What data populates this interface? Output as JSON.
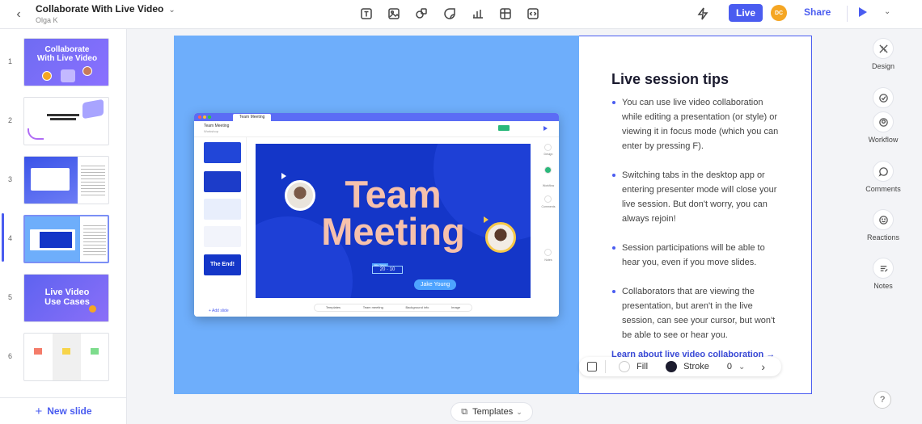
{
  "header": {
    "title": "Collaborate With Live Video",
    "owner": "Olga K",
    "live_label": "Live",
    "avatar_initials": "DC",
    "share_label": "Share",
    "tools": [
      "text-icon",
      "image-icon",
      "shapes-icon",
      "sticker-icon",
      "chart-icon",
      "table-icon",
      "embed-icon"
    ]
  },
  "sidebar": {
    "slides": [
      {
        "num": "1",
        "title": "Collaborate With Live Video"
      },
      {
        "num": "2",
        "title": ""
      },
      {
        "num": "3",
        "title": ""
      },
      {
        "num": "4",
        "title": ""
      },
      {
        "num": "5",
        "title": "Live Video Use Cases"
      },
      {
        "num": "6",
        "title": ""
      }
    ],
    "new_slide_label": "New slide",
    "active_slide": 4
  },
  "canvas": {
    "tips_title": "Live session tips",
    "tips": [
      "You can use live video collaboration while editing a presentation (or style) or viewing it in focus mode (which you can enter by pressing F).",
      "Switching tabs in the desktop app or entering presenter mode will close your live session. But don't worry, you can always rejoin!",
      "Session participations will be able to hear you, even if you move slides.",
      "Collaborators that are viewing the presentation, but aren't in the live session, can see your cursor, but won't be able to see or hear you."
    ],
    "learn_link": "Learn about live video collaboration →",
    "inner": {
      "tab_title": "Team Meeting",
      "doc_title": "Team Meeting",
      "owner": "Workshop",
      "slide_title_line1": "Team",
      "slide_title_line2": "Meeting",
      "name_tag": "Jake Young",
      "overlay_value": "20 · 10",
      "overlay_label": "Jake Young",
      "add_slide": "+ Add slide",
      "end_thumb": "The End!",
      "bottom_tools": [
        "Templates",
        "Team meeting",
        "Background info",
        "Image"
      ],
      "right_labels": [
        "Design",
        "Workflow",
        "Comments",
        "Notes"
      ]
    }
  },
  "fillbar": {
    "fill_label": "Fill",
    "stroke_label": "Stroke",
    "stroke_width": "0",
    "fill_color": "#ffffff",
    "stroke_color": "#1c1c2e"
  },
  "right_panel": {
    "items": [
      {
        "label": "Design",
        "icon": "design-icon"
      },
      {
        "label": "Workflow",
        "icon": "workflow-icon"
      },
      {
        "label": "Comments",
        "icon": "comments-icon"
      },
      {
        "label": "Reactions",
        "icon": "reactions-icon"
      },
      {
        "label": "Notes",
        "icon": "notes-icon"
      }
    ],
    "help": "?"
  },
  "templates_label": "Templates",
  "colors": {
    "accent": "#4a5cf0",
    "canvas_blue": "#6eaefb",
    "slide_blue": "#1436c8",
    "title_peach": "#f6c1ac"
  }
}
